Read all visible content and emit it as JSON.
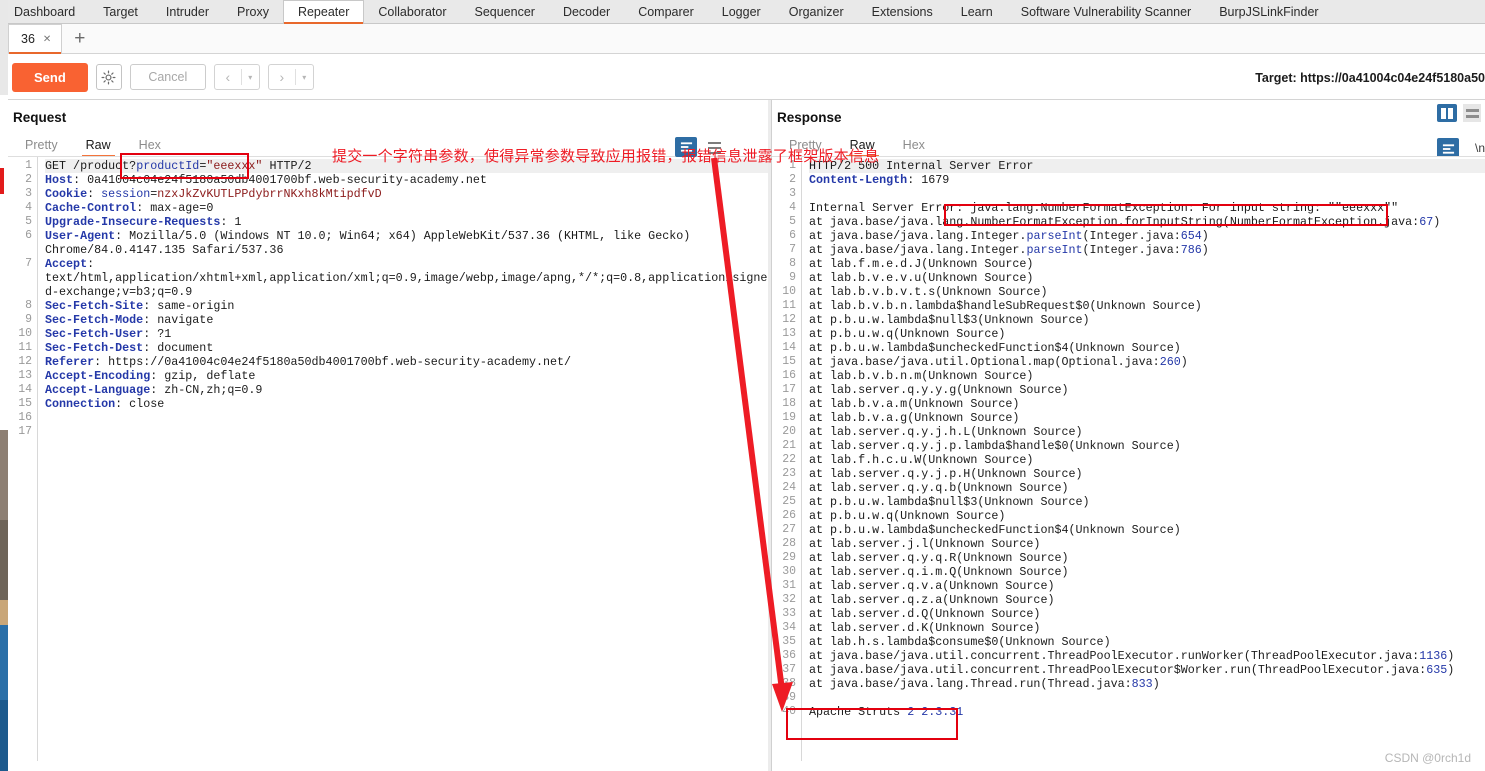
{
  "app": {
    "menu": [
      {
        "label": "Dashboard",
        "active": false
      },
      {
        "label": "Target",
        "active": false
      },
      {
        "label": "Intruder",
        "active": false
      },
      {
        "label": "Proxy",
        "active": false
      },
      {
        "label": "Repeater",
        "active": true
      },
      {
        "label": "Collaborator",
        "active": false
      },
      {
        "label": "Sequencer",
        "active": false
      },
      {
        "label": "Decoder",
        "active": false
      },
      {
        "label": "Comparer",
        "active": false
      },
      {
        "label": "Logger",
        "active": false
      },
      {
        "label": "Organizer",
        "active": false
      },
      {
        "label": "Extensions",
        "active": false
      },
      {
        "label": "Learn",
        "active": false
      },
      {
        "label": "Software Vulnerability Scanner",
        "active": false
      },
      {
        "label": "BurpJSLinkFinder",
        "active": false
      }
    ]
  },
  "tabstrip": {
    "tab_label": "36",
    "close_glyph": "✕",
    "add_glyph": "+"
  },
  "toolbar": {
    "send_label": "Send",
    "gear_icon": "gear-icon",
    "cancel_label": "Cancel",
    "prev_glyph": "‹",
    "next_glyph": "›",
    "dropdown_glyph": "▾",
    "target_label": "Target: https://0a41004c04e24f5180a50"
  },
  "request": {
    "title": "Request",
    "tabs": [
      {
        "label": "Pretty",
        "active": false
      },
      {
        "label": "Raw",
        "active": true
      },
      {
        "label": "Hex",
        "active": false
      }
    ],
    "lines": [
      {
        "n": "1",
        "segments": [
          {
            "t": "GET /product?",
            "c": "val"
          },
          {
            "t": "productId",
            "c": "blue"
          },
          {
            "t": "=",
            "c": "val"
          },
          {
            "t": "\"eeexxx\"",
            "c": "maroon"
          },
          {
            "t": " HTTP/2",
            "c": "val"
          }
        ],
        "highlight": true
      },
      {
        "n": "2",
        "segments": [
          {
            "t": "Host",
            "c": "hdr"
          },
          {
            "t": ": 0a41004c04e24f5180a50db4001700bf.web-security-academy.net",
            "c": "val"
          }
        ]
      },
      {
        "n": "3",
        "segments": [
          {
            "t": "Cookie",
            "c": "hdr"
          },
          {
            "t": ": ",
            "c": "val"
          },
          {
            "t": "session",
            "c": "blue"
          },
          {
            "t": "=",
            "c": "val"
          },
          {
            "t": "nzxJkZvKUTLPPdybrrNKxh8kMtipdfvD",
            "c": "maroon"
          }
        ]
      },
      {
        "n": "4",
        "segments": [
          {
            "t": "Cache-Control",
            "c": "hdr"
          },
          {
            "t": ": max-age=0",
            "c": "val"
          }
        ]
      },
      {
        "n": "5",
        "segments": [
          {
            "t": "Upgrade-Insecure-Requests",
            "c": "hdr"
          },
          {
            "t": ": 1",
            "c": "val"
          }
        ]
      },
      {
        "n": "6",
        "segments": [
          {
            "t": "User-Agent",
            "c": "hdr"
          },
          {
            "t": ": Mozilla/5.0 (Windows NT 10.0; Win64; x64) AppleWebKit/537.36 (KHTML, like Gecko)",
            "c": "val"
          }
        ]
      },
      {
        "n": "",
        "segments": [
          {
            "t": "Chrome/84.0.4147.135 Safari/537.36",
            "c": "val"
          }
        ]
      },
      {
        "n": "7",
        "segments": [
          {
            "t": "Accept",
            "c": "hdr"
          },
          {
            "t": ":",
            "c": "val"
          }
        ]
      },
      {
        "n": "",
        "segments": [
          {
            "t": "text/html,application/xhtml+xml,application/xml;q=0.9,image/webp,image/apng,*/*;q=0.8,application/signe",
            "c": "val"
          }
        ]
      },
      {
        "n": "",
        "segments": [
          {
            "t": "d-exchange;v=b3;q=0.9",
            "c": "val"
          }
        ]
      },
      {
        "n": "8",
        "segments": [
          {
            "t": "Sec-Fetch-Site",
            "c": "hdr"
          },
          {
            "t": ": same-origin",
            "c": "val"
          }
        ]
      },
      {
        "n": "9",
        "segments": [
          {
            "t": "Sec-Fetch-Mode",
            "c": "hdr"
          },
          {
            "t": ": navigate",
            "c": "val"
          }
        ]
      },
      {
        "n": "10",
        "segments": [
          {
            "t": "Sec-Fetch-User",
            "c": "hdr"
          },
          {
            "t": ": ?1",
            "c": "val"
          }
        ]
      },
      {
        "n": "11",
        "segments": [
          {
            "t": "Sec-Fetch-Dest",
            "c": "hdr"
          },
          {
            "t": ": document",
            "c": "val"
          }
        ]
      },
      {
        "n": "12",
        "segments": [
          {
            "t": "Referer",
            "c": "hdr"
          },
          {
            "t": ": https://0a41004c04e24f5180a50db4001700bf.web-security-academy.net/",
            "c": "val"
          }
        ]
      },
      {
        "n": "13",
        "segments": [
          {
            "t": "Accept-Encoding",
            "c": "hdr"
          },
          {
            "t": ": gzip, deflate",
            "c": "val"
          }
        ]
      },
      {
        "n": "14",
        "segments": [
          {
            "t": "Accept-Language",
            "c": "hdr"
          },
          {
            "t": ": zh-CN,zh;q=0.9",
            "c": "val"
          }
        ]
      },
      {
        "n": "15",
        "segments": [
          {
            "t": "Connection",
            "c": "hdr"
          },
          {
            "t": ": close",
            "c": "val"
          }
        ]
      },
      {
        "n": "16",
        "segments": [
          {
            "t": "",
            "c": "val"
          }
        ]
      },
      {
        "n": "17",
        "segments": [
          {
            "t": "",
            "c": "val"
          }
        ]
      }
    ]
  },
  "response": {
    "title": "Response",
    "tabs": [
      {
        "label": "Pretty",
        "active": false
      },
      {
        "label": "Raw",
        "active": true
      },
      {
        "label": "Hex",
        "active": false
      }
    ],
    "wrap_label": "\\n",
    "lines": [
      {
        "n": "1",
        "segments": [
          {
            "t": "HTTP/2 500 Internal Server Error",
            "c": "val"
          }
        ],
        "highlight": true
      },
      {
        "n": "2",
        "segments": [
          {
            "t": "Content-Length",
            "c": "hdr"
          },
          {
            "t": ": 1679",
            "c": "val"
          }
        ]
      },
      {
        "n": "3",
        "segments": [
          {
            "t": "",
            "c": "val"
          }
        ]
      },
      {
        "n": "4",
        "segments": [
          {
            "t": "Internal Server Error: java.lang.NumberFormatException: For input string: \"\"eeexxx\"\"",
            "c": "val"
          }
        ]
      },
      {
        "n": "5",
        "segments": [
          {
            "t": "at java.base/java.lang.NumberFormatException.forInputString(NumberFormatException.java:",
            "c": "val"
          },
          {
            "t": "67",
            "c": "num"
          },
          {
            "t": ")",
            "c": "val"
          }
        ]
      },
      {
        "n": "6",
        "segments": [
          {
            "t": "at java.base/java.lang.Integer.",
            "c": "val"
          },
          {
            "t": "parseInt",
            "c": "blue"
          },
          {
            "t": "(Integer.java:",
            "c": "val"
          },
          {
            "t": "654",
            "c": "num"
          },
          {
            "t": ")",
            "c": "val"
          }
        ]
      },
      {
        "n": "7",
        "segments": [
          {
            "t": "at java.base/java.lang.Integer.",
            "c": "val"
          },
          {
            "t": "parseInt",
            "c": "blue"
          },
          {
            "t": "(Integer.java:",
            "c": "val"
          },
          {
            "t": "786",
            "c": "num"
          },
          {
            "t": ")",
            "c": "val"
          }
        ]
      },
      {
        "n": "8",
        "segments": [
          {
            "t": "at lab.f.m.e.d.J(Unknown Source)",
            "c": "val"
          }
        ]
      },
      {
        "n": "9",
        "segments": [
          {
            "t": "at lab.b.v.e.v.u(Unknown Source)",
            "c": "val"
          }
        ]
      },
      {
        "n": "10",
        "segments": [
          {
            "t": "at lab.b.v.b.v.t.s(Unknown Source)",
            "c": "val"
          }
        ]
      },
      {
        "n": "11",
        "segments": [
          {
            "t": "at lab.b.v.b.n.lambda$handleSubRequest$0(Unknown Source)",
            "c": "val"
          }
        ]
      },
      {
        "n": "12",
        "segments": [
          {
            "t": "at p.b.u.w.lambda$null$3(Unknown Source)",
            "c": "val"
          }
        ]
      },
      {
        "n": "13",
        "segments": [
          {
            "t": "at p.b.u.w.q(Unknown Source)",
            "c": "val"
          }
        ]
      },
      {
        "n": "14",
        "segments": [
          {
            "t": "at p.b.u.w.lambda$uncheckedFunction$4(Unknown Source)",
            "c": "val"
          }
        ]
      },
      {
        "n": "15",
        "segments": [
          {
            "t": "at java.base/java.util.Optional.map(Optional.java:",
            "c": "val"
          },
          {
            "t": "260",
            "c": "num"
          },
          {
            "t": ")",
            "c": "val"
          }
        ]
      },
      {
        "n": "16",
        "segments": [
          {
            "t": "at lab.b.v.b.n.m(Unknown Source)",
            "c": "val"
          }
        ]
      },
      {
        "n": "17",
        "segments": [
          {
            "t": "at lab.server.q.y.y.g(Unknown Source)",
            "c": "val"
          }
        ]
      },
      {
        "n": "18",
        "segments": [
          {
            "t": "at lab.b.v.a.m(Unknown Source)",
            "c": "val"
          }
        ]
      },
      {
        "n": "19",
        "segments": [
          {
            "t": "at lab.b.v.a.g(Unknown Source)",
            "c": "val"
          }
        ]
      },
      {
        "n": "20",
        "segments": [
          {
            "t": "at lab.server.q.y.j.h.L(Unknown Source)",
            "c": "val"
          }
        ]
      },
      {
        "n": "21",
        "segments": [
          {
            "t": "at lab.server.q.y.j.p.lambda$handle$0(Unknown Source)",
            "c": "val"
          }
        ]
      },
      {
        "n": "22",
        "segments": [
          {
            "t": "at lab.f.h.c.u.W(Unknown Source)",
            "c": "val"
          }
        ]
      },
      {
        "n": "23",
        "segments": [
          {
            "t": "at lab.server.q.y.j.p.H(Unknown Source)",
            "c": "val"
          }
        ]
      },
      {
        "n": "24",
        "segments": [
          {
            "t": "at lab.server.q.y.q.b(Unknown Source)",
            "c": "val"
          }
        ]
      },
      {
        "n": "25",
        "segments": [
          {
            "t": "at p.b.u.w.lambda$null$3(Unknown Source)",
            "c": "val"
          }
        ]
      },
      {
        "n": "26",
        "segments": [
          {
            "t": "at p.b.u.w.q(Unknown Source)",
            "c": "val"
          }
        ]
      },
      {
        "n": "27",
        "segments": [
          {
            "t": "at p.b.u.w.lambda$uncheckedFunction$4(Unknown Source)",
            "c": "val"
          }
        ]
      },
      {
        "n": "28",
        "segments": [
          {
            "t": "at lab.server.j.l(Unknown Source)",
            "c": "val"
          }
        ]
      },
      {
        "n": "29",
        "segments": [
          {
            "t": "at lab.server.q.y.q.R(Unknown Source)",
            "c": "val"
          }
        ]
      },
      {
        "n": "30",
        "segments": [
          {
            "t": "at lab.server.q.i.m.Q(Unknown Source)",
            "c": "val"
          }
        ]
      },
      {
        "n": "31",
        "segments": [
          {
            "t": "at lab.server.q.v.a(Unknown Source)",
            "c": "val"
          }
        ]
      },
      {
        "n": "32",
        "segments": [
          {
            "t": "at lab.server.q.z.a(Unknown Source)",
            "c": "val"
          }
        ]
      },
      {
        "n": "33",
        "segments": [
          {
            "t": "at lab.server.d.Q(Unknown Source)",
            "c": "val"
          }
        ]
      },
      {
        "n": "34",
        "segments": [
          {
            "t": "at lab.server.d.K(Unknown Source)",
            "c": "val"
          }
        ]
      },
      {
        "n": "35",
        "segments": [
          {
            "t": "at lab.h.s.lambda$consume$0(Unknown Source)",
            "c": "val"
          }
        ]
      },
      {
        "n": "36",
        "segments": [
          {
            "t": "at java.base/java.util.concurrent.ThreadPoolExecutor.runWorker(ThreadPoolExecutor.java:",
            "c": "val"
          },
          {
            "t": "1136",
            "c": "num"
          },
          {
            "t": ")",
            "c": "val"
          }
        ]
      },
      {
        "n": "37",
        "segments": [
          {
            "t": "at java.base/java.util.concurrent.ThreadPoolExecutor$Worker.run(ThreadPoolExecutor.java:",
            "c": "val"
          },
          {
            "t": "635",
            "c": "num"
          },
          {
            "t": ")",
            "c": "val"
          }
        ]
      },
      {
        "n": "38",
        "segments": [
          {
            "t": "at java.base/java.lang.Thread.run(Thread.java:",
            "c": "val"
          },
          {
            "t": "833",
            "c": "num"
          },
          {
            "t": ")",
            "c": "val"
          }
        ]
      },
      {
        "n": "39",
        "segments": [
          {
            "t": "",
            "c": "val"
          }
        ]
      },
      {
        "n": "40",
        "segments": [
          {
            "t": "Apache Struts ",
            "c": "val"
          },
          {
            "t": "2 2.3.31",
            "c": "num"
          }
        ]
      }
    ]
  },
  "annotations": {
    "note": "提交一个字符串参数，使得异常参数导致应用报错，报错信息泄露了框架版本信息",
    "color": "#ee1c25"
  },
  "watermark": "CSDN @0rch1d",
  "colors": {
    "accent_orange": "#e8682c",
    "send_orange": "#f96232",
    "annotation_red": "#ee1c25",
    "icon_blue": "#2e6da4",
    "header_blue": "#2438a8"
  }
}
